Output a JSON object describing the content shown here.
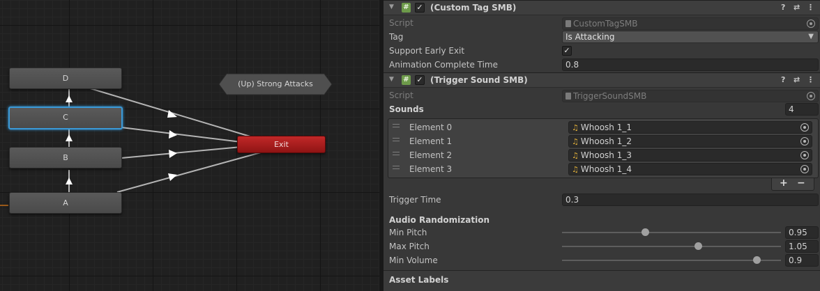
{
  "graph": {
    "states": {
      "d": "D",
      "c": "C",
      "b": "B",
      "a": "A"
    },
    "exit": "Exit",
    "sub_state_machine": "(Up) Strong Attacks"
  },
  "inspector": {
    "custom_tag": {
      "title": "(Custom Tag SMB)",
      "script_label": "Script",
      "script_value": "CustomTagSMB",
      "tag_label": "Tag",
      "tag_value": "Is Attacking",
      "early_exit_label": "Support Early Exit",
      "early_exit_checked": true,
      "anim_complete_label": "Animation Complete Time",
      "anim_complete_value": "0.8"
    },
    "trigger_sound": {
      "title": "(Trigger Sound SMB)",
      "script_label": "Script",
      "script_value": "TriggerSoundSMB",
      "sounds_label": "Sounds",
      "sounds_count": "4",
      "elements": [
        {
          "label": "Element 0",
          "value": "Whoosh 1_1"
        },
        {
          "label": "Element 1",
          "value": "Whoosh 1_2"
        },
        {
          "label": "Element 2",
          "value": "Whoosh 1_3"
        },
        {
          "label": "Element 3",
          "value": "Whoosh 1_4"
        }
      ],
      "add_label": "+",
      "remove_label": "−",
      "trigger_time_label": "Trigger Time",
      "trigger_time_value": "0.3",
      "audio_rand_label": "Audio Randomization",
      "sliders": [
        {
          "label": "Min Pitch",
          "value": "0.95",
          "fraction": 0.38
        },
        {
          "label": "Max Pitch",
          "value": "1.05",
          "fraction": 0.62
        },
        {
          "label": "Min Volume",
          "value": "0.9",
          "fraction": 0.89
        }
      ]
    },
    "asset_labels": "Asset Labels",
    "icons": [
      "fold-arrow-icon",
      "script-icon",
      "help-icon",
      "preset-icon",
      "more-menu-icon",
      "object-picker-icon",
      "audio-clip-icon",
      "drag-handle-icon"
    ]
  }
}
